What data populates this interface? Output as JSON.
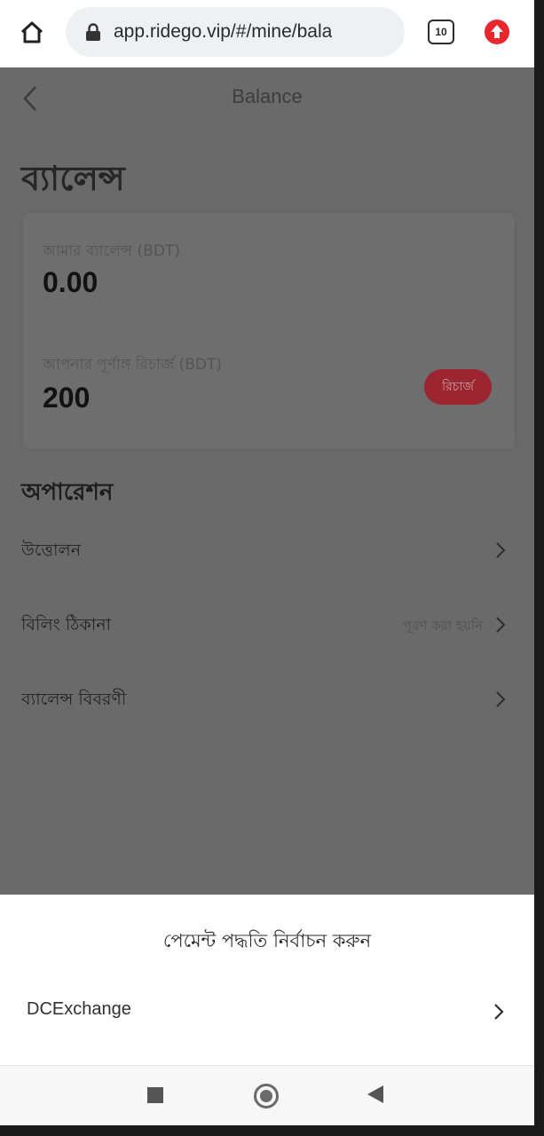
{
  "browser": {
    "url": "app.ridego.vip/#/mine/bala",
    "tab_count": "10",
    "icons": {
      "home": "home-icon",
      "lock": "lock-icon",
      "update": "update-arrow-icon"
    },
    "accent_color": "#e8262b"
  },
  "header": {
    "title": "Balance",
    "back_icon": "chevron-left-icon"
  },
  "page_heading": "ব্যালেন্স",
  "balance_card": {
    "my_balance_label": "আমার ব্যালেন্স (BDT)",
    "my_balance_value": "0.00",
    "full_recharge_label": "আপনার পূর্ণাঙ্গ রিচার্জ (BDT)",
    "full_recharge_value": "200",
    "recharge_button": "রিচার্জ",
    "recharge_color": "#9b2530"
  },
  "operations": {
    "heading": "অপারেশন",
    "items": [
      {
        "label": "উত্তোলন",
        "hint": ""
      },
      {
        "label": "বিলিং ঠিকানা",
        "hint": "পূরণ করা হয়নি"
      },
      {
        "label": "ব্যালেন্স বিবরণী",
        "hint": ""
      }
    ]
  },
  "payment_sheet": {
    "title": "পেমেন্ট পদ্ধতি নির্বাচন করুন",
    "methods": [
      {
        "label": "DCExchange"
      }
    ]
  },
  "system_nav": {
    "recent": "recent-apps-icon",
    "home": "home-circle-icon",
    "back": "back-triangle-icon"
  }
}
